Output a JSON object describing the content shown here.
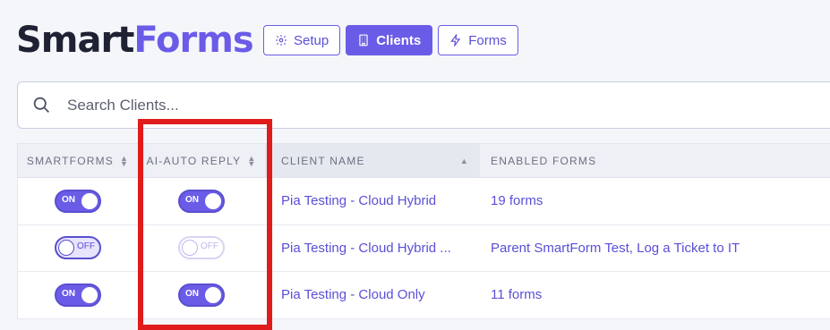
{
  "brand": {
    "part1": "Smart",
    "part2": "Forms"
  },
  "nav": [
    {
      "label": "Setup",
      "icon": "gear-icon",
      "active": false
    },
    {
      "label": "Clients",
      "icon": "building-icon",
      "active": true
    },
    {
      "label": "Forms",
      "icon": "lightning-icon",
      "active": false
    }
  ],
  "search": {
    "placeholder": "Search Clients...",
    "value": ""
  },
  "table": {
    "headers": [
      "SMARTFORMS",
      "AI-AUTO REPLY",
      "CLIENT NAME",
      "ENABLED FORMS"
    ],
    "rows": [
      {
        "smartforms": "ON",
        "ai_auto_reply": "ON",
        "ai_disabled": false,
        "client_name": "Pia Testing - Cloud Hybrid",
        "enabled_forms": "19 forms"
      },
      {
        "smartforms": "OFF",
        "ai_auto_reply": "OFF",
        "ai_disabled": true,
        "client_name": "Pia Testing - Cloud Hybrid ...",
        "enabled_forms": "Parent SmartForm Test, Log a Ticket to IT"
      },
      {
        "smartforms": "ON",
        "ai_auto_reply": "ON",
        "ai_disabled": false,
        "client_name": "Pia Testing - Cloud Only",
        "enabled_forms": "11 forms"
      }
    ]
  },
  "colors": {
    "accent": "#6b5ce7",
    "highlight": "#e01b1b",
    "brand_dark": "#1f2233"
  }
}
